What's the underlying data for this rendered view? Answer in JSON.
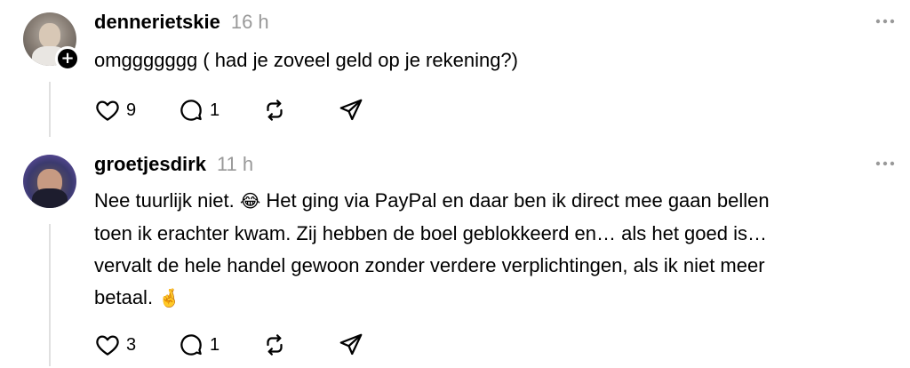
{
  "posts": [
    {
      "username": "dennerietskie",
      "time": "16 h",
      "text": "omggggggg ( had je zoveel geld op je rekening?)",
      "likes": "9",
      "replies": "1",
      "follow_symbol": "+"
    },
    {
      "username": "groetjesdirk",
      "time": "11 h",
      "text_before_emoji1": "Nee tuurlijk niet. ",
      "emoji1": "😂",
      "text_after_emoji1": " Het ging via PayPal en daar ben ik direct mee gaan bellen\ntoen ik erachter kwam. Zij hebben de boel geblokkeerd en… als het goed is…\nvervalt de hele handel gewoon zonder verdere verplichtingen, als ik niet meer\nbetaal. ",
      "emoji2": "🤞",
      "likes": "3",
      "replies": "1"
    }
  ],
  "icons": [
    "more-icon",
    "heart-icon",
    "reply-icon",
    "repost-icon",
    "share-icon"
  ]
}
